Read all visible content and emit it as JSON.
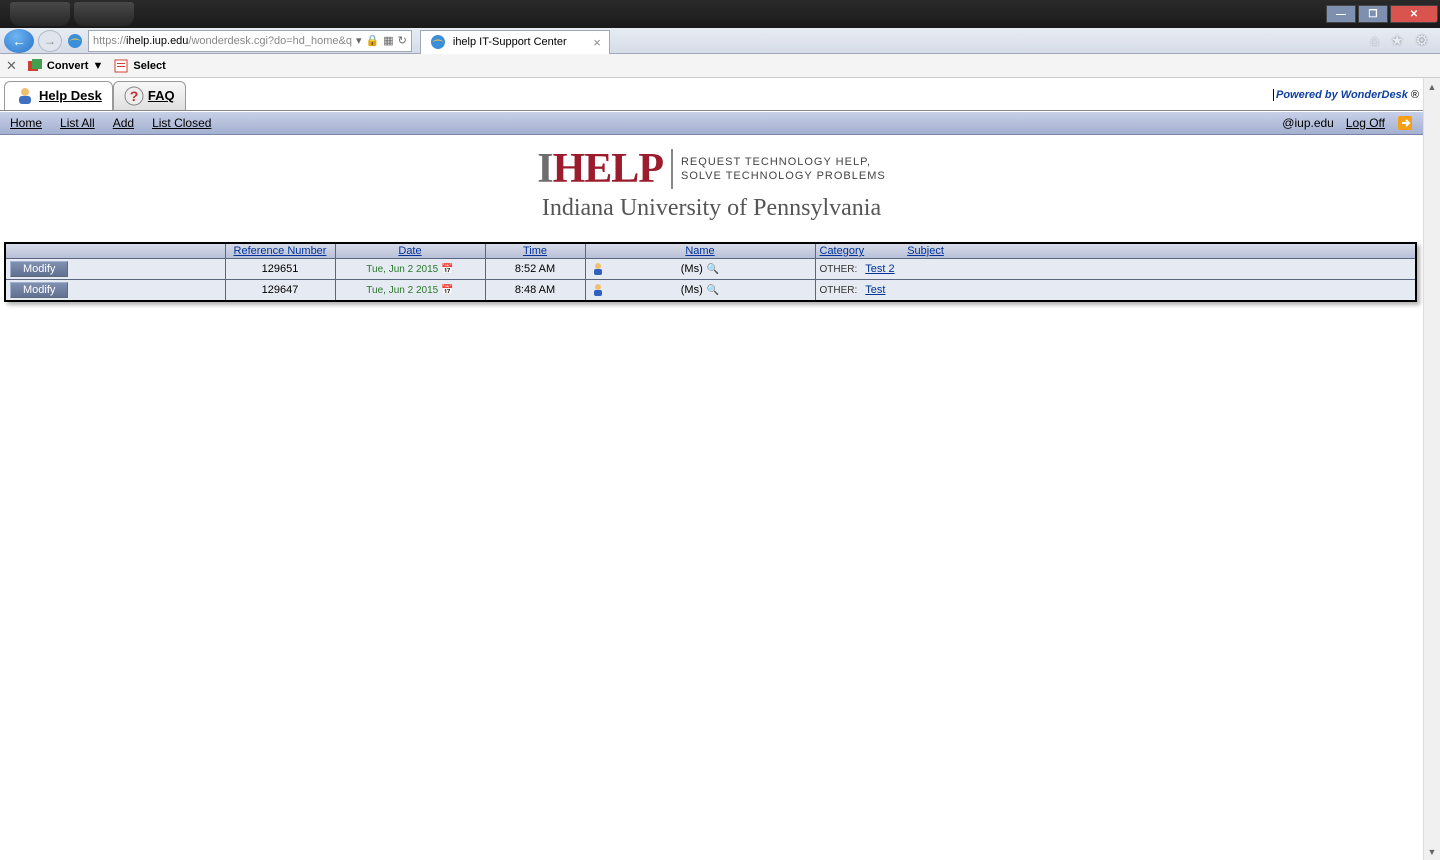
{
  "browser": {
    "url_prefix": "https://",
    "url_domain": "ihelp.iup.edu",
    "url_path": "/wonderdesk.cgi?do=hd_home&q",
    "tab_title": "ihelp IT-Support Center"
  },
  "toolbar": {
    "convert": "Convert",
    "select": "Select"
  },
  "app_tabs": {
    "helpdesk": "Help Desk",
    "faq": "FAQ"
  },
  "powered": {
    "text": "Powered by WonderDesk",
    "reg": " ®"
  },
  "linkbar": {
    "home": "Home",
    "list_all": "List All",
    "add": "Add",
    "list_closed": "List Closed",
    "user": "@iup.edu",
    "logoff": "Log Off"
  },
  "logo": {
    "i": "I",
    "help": "HELP",
    "tag1": "REQUEST TECHNOLOGY HELP,",
    "tag2": "SOLVE TECHNOLOGY PROBLEMS",
    "univ": "Indiana University of Pennsylvania"
  },
  "table": {
    "headers": {
      "ref": "Reference Number",
      "date": "Date",
      "time": "Time",
      "name": "Name",
      "category": "Category",
      "subject": "Subject"
    },
    "modify_label": "Modify",
    "rows": [
      {
        "ref": "129651",
        "date": "Tue, Jun 2 2015",
        "time": "8:52 AM",
        "name": "(Ms)",
        "category": "OTHER:",
        "subject": "Test 2"
      },
      {
        "ref": "129647",
        "date": "Tue, Jun 2 2015",
        "time": "8:48 AM",
        "name": "(Ms)",
        "category": "OTHER:",
        "subject": "Test"
      }
    ]
  }
}
